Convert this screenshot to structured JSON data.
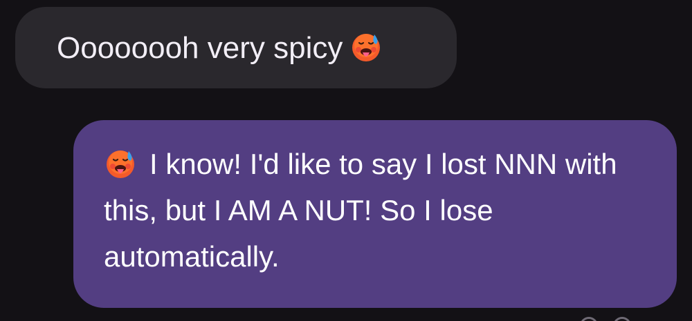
{
  "conversation": {
    "messages": [
      {
        "direction": "incoming",
        "text": "Oooooooh very spicy",
        "emoji": "hot-face-emoji"
      },
      {
        "direction": "outgoing",
        "emoji": "hot-face-emoji",
        "text": "I know! I'd like to say I lost NNN with this, but I AM A NUT! So I lose automatically."
      }
    ]
  },
  "colors": {
    "background": "#131115",
    "incoming_bubble": "#2a282d",
    "outgoing_bubble": "#533e82",
    "text": "#ffffff"
  }
}
